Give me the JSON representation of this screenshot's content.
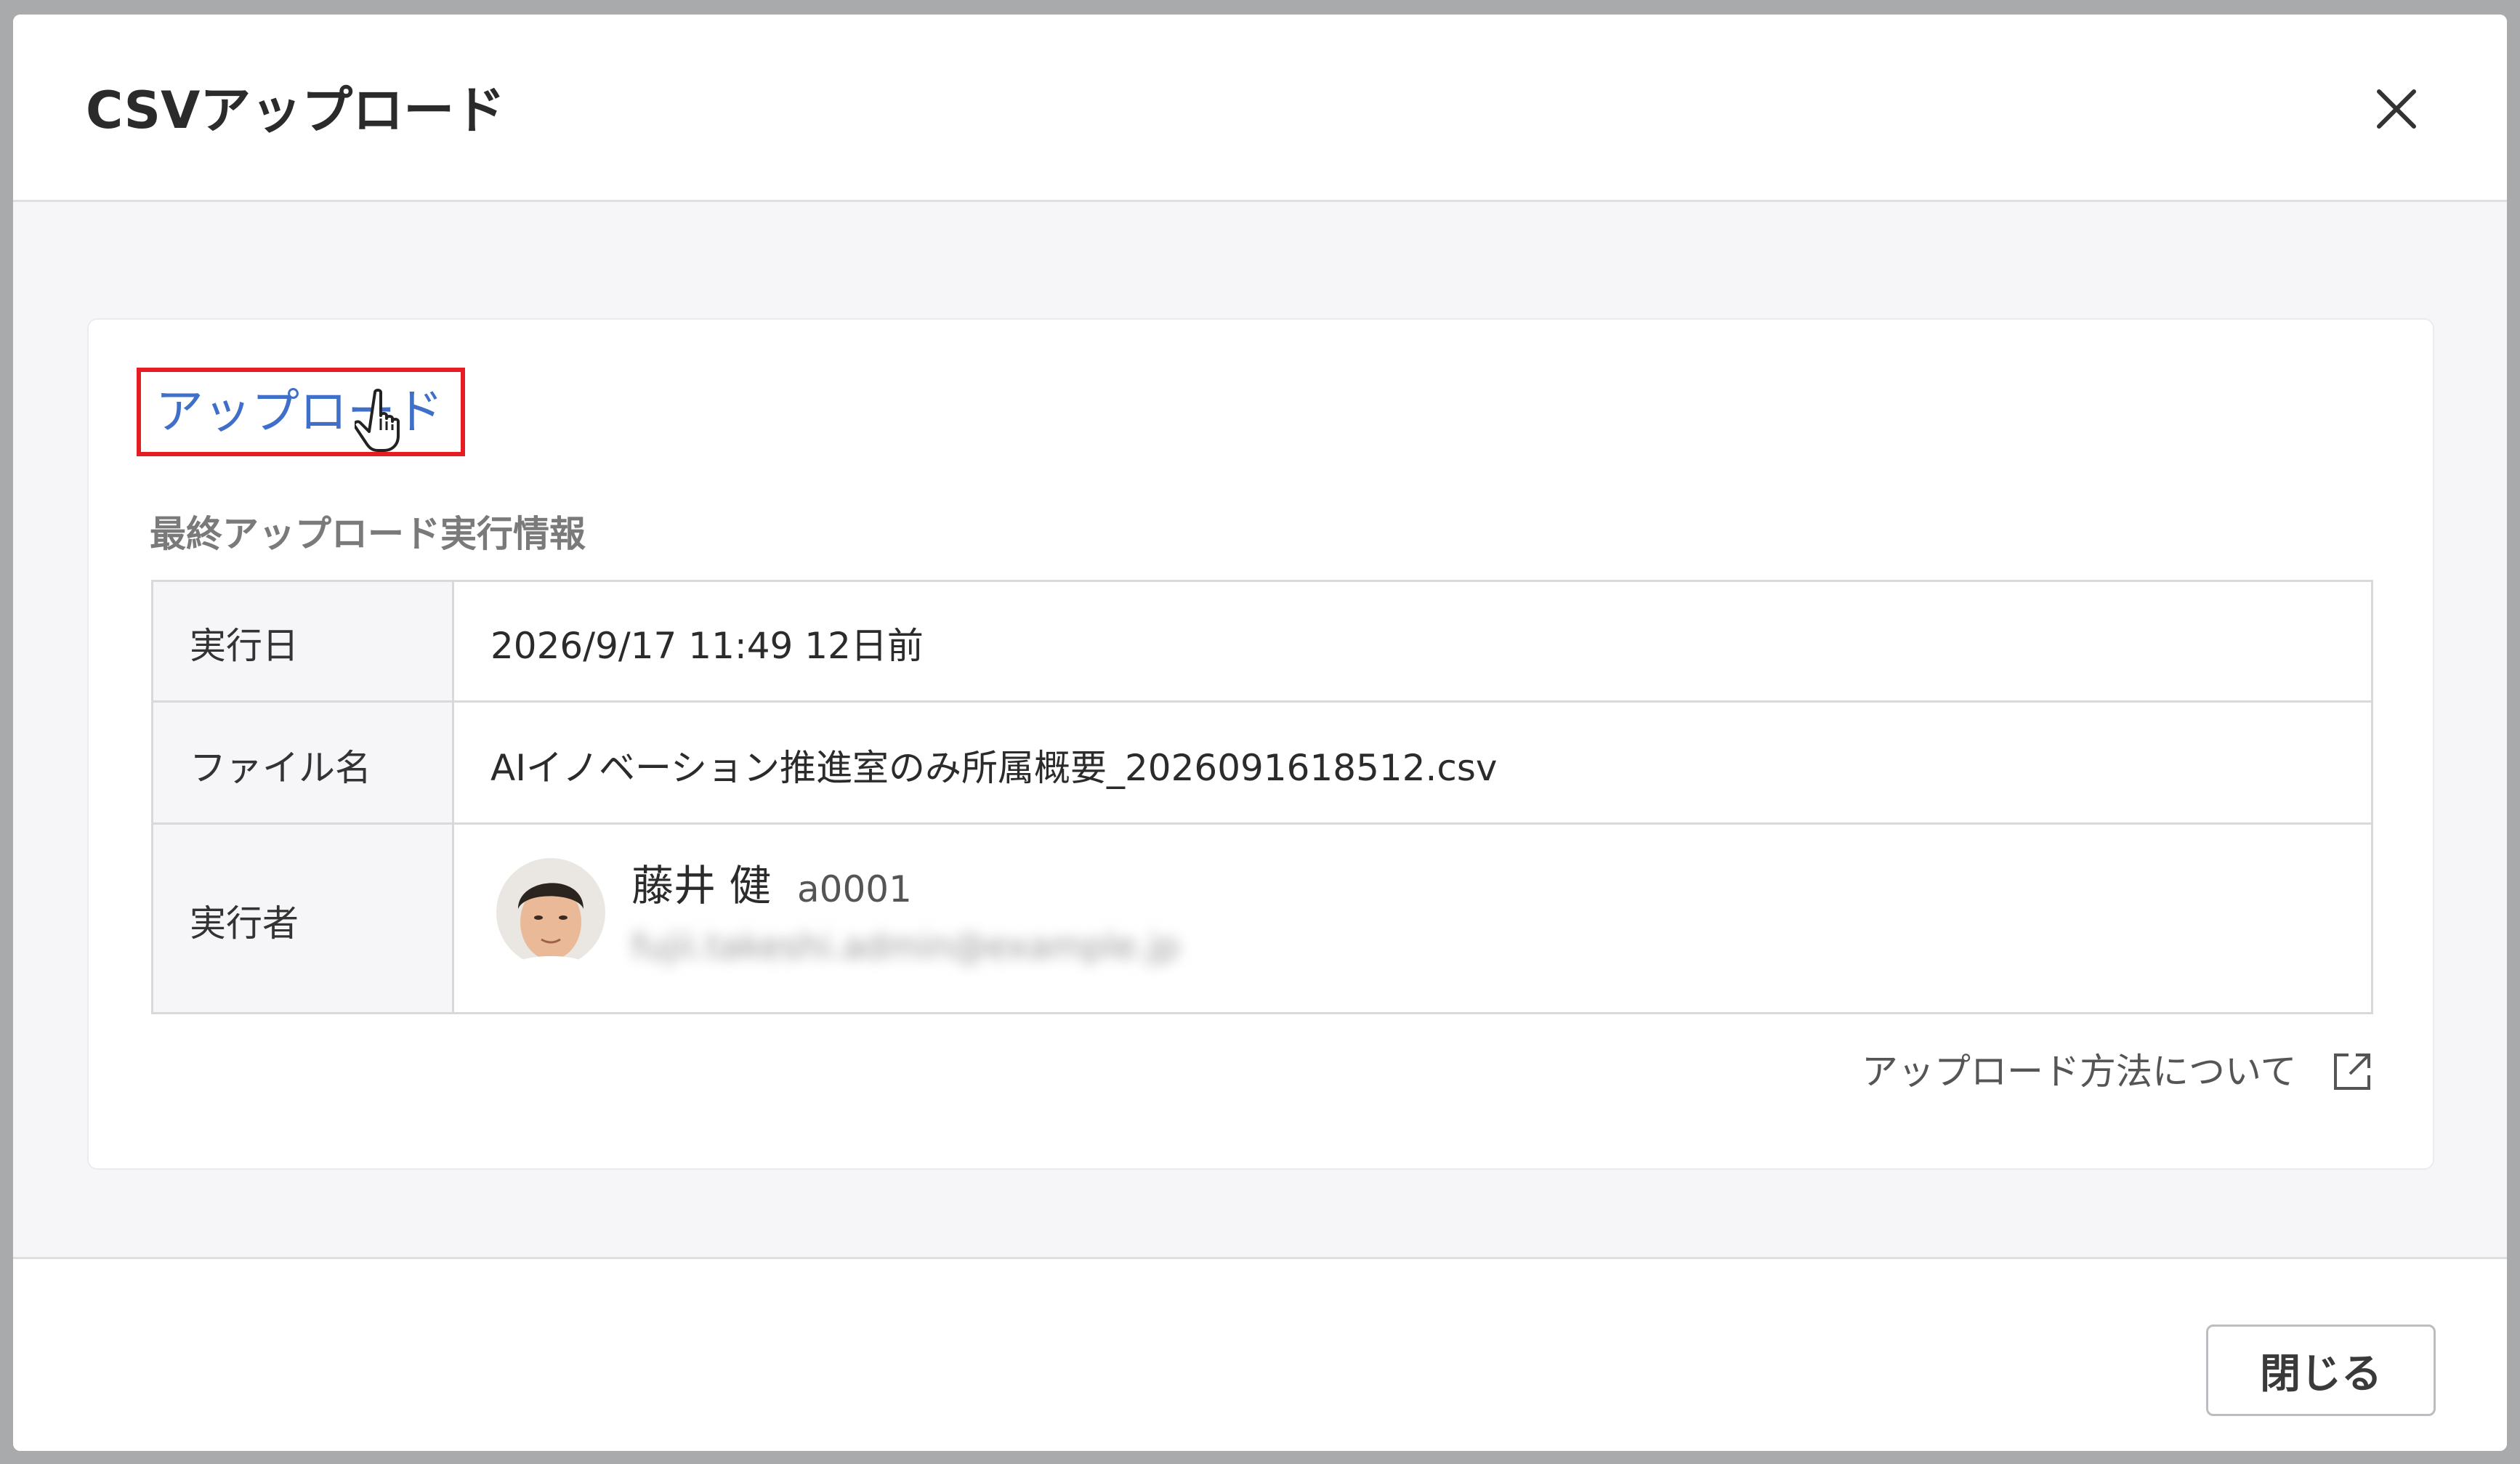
{
  "dialog": {
    "title": "CSVアップロード",
    "close_icon": "close-icon"
  },
  "card": {
    "upload_link": "アップロード",
    "section_label": "最終アップロード実行情報",
    "rows": [
      {
        "label": "実行日",
        "value": "2026/9/17 11:49 12日前"
      },
      {
        "label": "ファイル名",
        "value": "AIイノベーション推進室のみ所属概要_2026091618512.csv"
      },
      {
        "label": "実行者"
      }
    ],
    "executor": {
      "name": "藤井 健",
      "id": "a0001",
      "email": "fujii.takeshi.admin@example.jp"
    },
    "help_link": "アップロード方法について",
    "help_icon": "external-link-icon"
  },
  "footer": {
    "close_button": "閉じる"
  },
  "colors": {
    "accent_link": "#3f6fc8",
    "highlight_box": "#e51c23"
  }
}
